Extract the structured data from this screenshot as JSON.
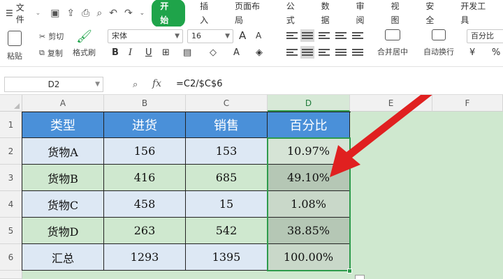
{
  "menubar": {
    "file_label": "文件",
    "tabs": [
      "开始",
      "插入",
      "页面布局",
      "公式",
      "数据",
      "审阅",
      "视图",
      "安全",
      "开发工具"
    ]
  },
  "ribbon": {
    "paste_label": "粘贴",
    "cut_label": "剪切",
    "copy_label": "复制",
    "format_painter_label": "格式刷",
    "font_name": "宋体",
    "font_size": "16",
    "bold": "B",
    "italic": "I",
    "underline": "U",
    "font_grow": "A",
    "font_shrink": "A",
    "merge_label": "合并居中",
    "wrap_label": "自动换行",
    "number_format": "百分比",
    "currency_symbol": "¥",
    "percent_symbol": "%"
  },
  "formula_bar": {
    "name_box": "D2",
    "fx": "fx",
    "formula": "=C2/$C$6"
  },
  "sheet": {
    "columns": [
      "A",
      "B",
      "C",
      "D",
      "E",
      "F"
    ],
    "rows": [
      "1",
      "2",
      "3",
      "4",
      "5",
      "6"
    ],
    "header": [
      "类型",
      "进货",
      "销售",
      "百分比"
    ],
    "data": [
      [
        "货物A",
        "156",
        "153",
        "10.97%"
      ],
      [
        "货物B",
        "416",
        "685",
        "49.10%"
      ],
      [
        "货物C",
        "458",
        "15",
        "1.08%"
      ],
      [
        "货物D",
        "263",
        "542",
        "38.85%"
      ],
      [
        "汇总",
        "1293",
        "1395",
        "100.00%"
      ]
    ]
  },
  "colors": {
    "accent_green": "#1fa44a",
    "header_blue": "#4a90d9",
    "annotation_red": "#e02020"
  }
}
